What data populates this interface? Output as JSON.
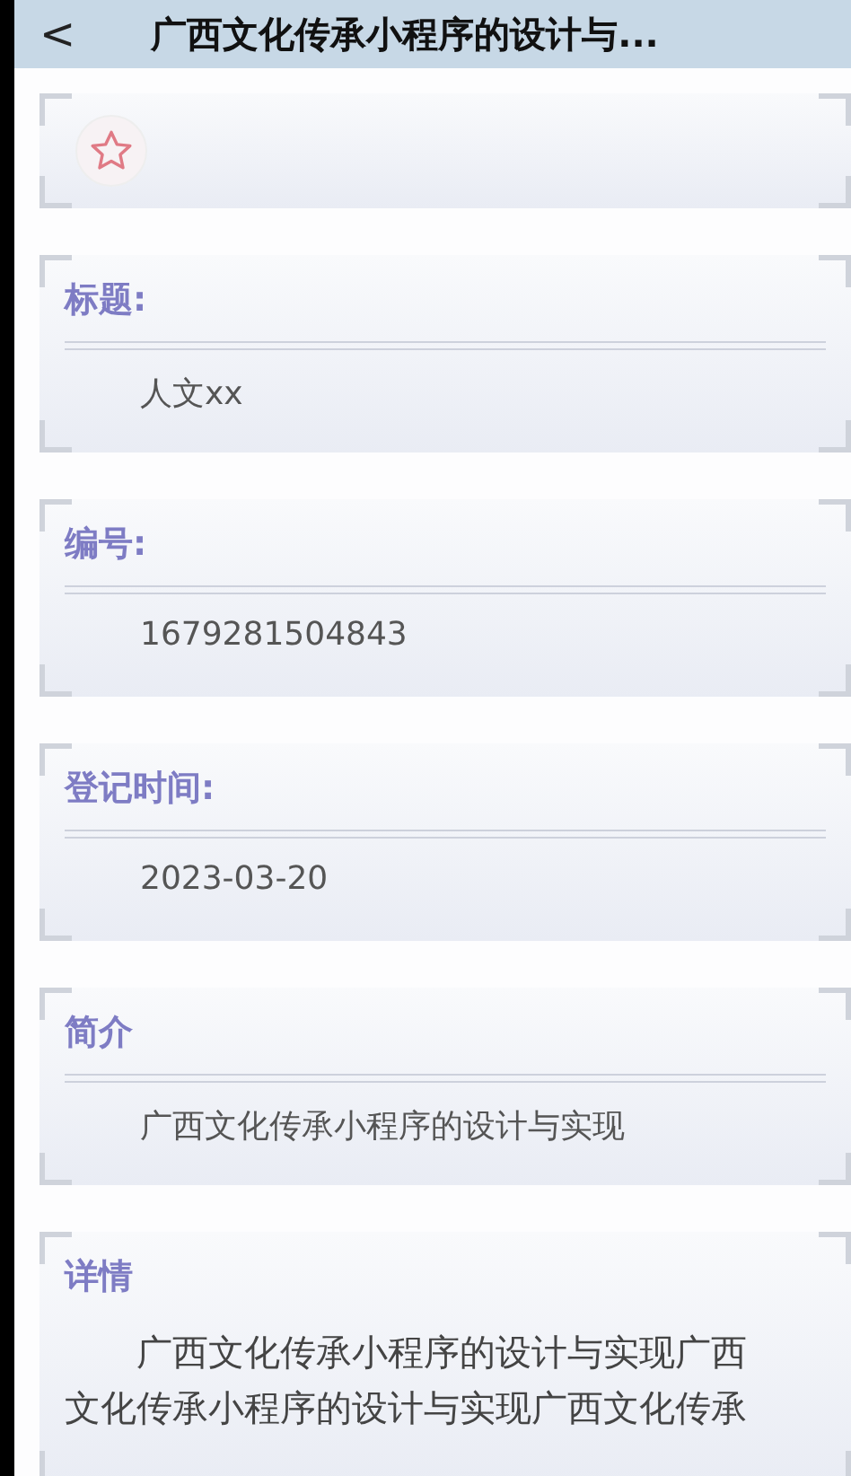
{
  "header": {
    "back": "<",
    "title": "广西文化传承小程序的设计与..."
  },
  "cards": [
    {
      "kind": "favorite",
      "favorited": false
    },
    {
      "kind": "field",
      "label": "标题:",
      "value": "人文xx"
    },
    {
      "kind": "field",
      "label": "编号:",
      "value": "1679281504843"
    },
    {
      "kind": "field",
      "label": "登记时间:",
      "value": "2023-03-20"
    },
    {
      "kind": "field",
      "label": "简介",
      "value": "广西文化传承小程序的设计与实现"
    },
    {
      "kind": "details",
      "label": "详情",
      "value": "广西文化传承小程序的设计与实现广西文化传承小程序的设计与实现广西文化传承"
    }
  ]
}
